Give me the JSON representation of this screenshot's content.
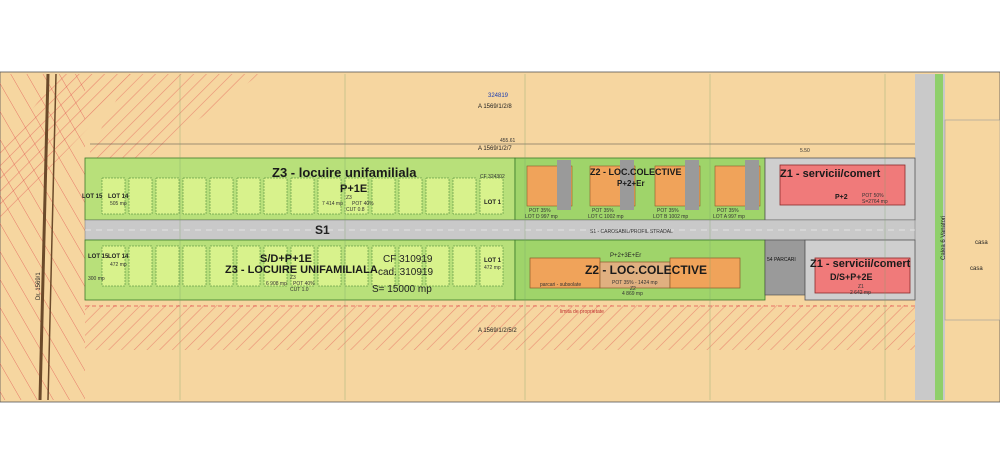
{
  "colors": {
    "background": "#f6d6a0",
    "z3_zone": "#b8e07a",
    "z3_lot": "#d8f28c",
    "z2_zone": "#9fd46a",
    "z2_building": "#f0a35a",
    "z1_building": "#f07a7a",
    "road": "#c9c9c9",
    "hatch": "#e05050",
    "grey_block": "#9a9a9a"
  },
  "top_strip": {
    "cad_number": "324819",
    "parcel_top": "A 1569/1/2/8",
    "parcel_mid": "A 1569/1/2/7",
    "dim_top": "455.61",
    "dim_right": "5.50"
  },
  "zones": {
    "z3_north": {
      "title": "Z3 - locuire unifamiliala",
      "regime": "P+1E",
      "info_name": "Z3",
      "info_area": "7 414 mp",
      "info_pot": "POT 40%",
      "info_cut": "CUT 0.8",
      "cf_label": "CF 324302"
    },
    "z3_south": {
      "regime": "S/D+P+1E",
      "title": "Z3 - LOCUIRE UNIFAMILIALA",
      "info_name": "Z3",
      "info_area": "6 908 mp",
      "info_pot": "POT 40%",
      "info_cut": "CUT 1.0"
    },
    "z2_north": {
      "title": "Z2 - LOC.COLECTIVE",
      "regime": "P+2+Er",
      "lots": [
        {
          "name": "LOT D",
          "area": "997 mp",
          "pot": "POT 35%"
        },
        {
          "name": "LOT C",
          "area": "1002 mp",
          "pot": "POT 35%"
        },
        {
          "name": "LOT B",
          "area": "1002 mp",
          "pot": "POT 35%"
        },
        {
          "name": "LOT A",
          "area": "997 mp",
          "pot": "POT 35%"
        }
      ]
    },
    "z2_south": {
      "title": "Z2 - LOC.COLECTIVE",
      "regime": "P+2+3E+Er",
      "info_name": "Z2",
      "info_area": "4 869 mp",
      "info_pot": "POT 35% - 1424 mp",
      "parking_note": "parcari - subsolate"
    },
    "z1_north": {
      "title": "Z1 - servicii/comert",
      "regime": "P+2",
      "pot": "POT 50%",
      "area": "S=2764 mp"
    },
    "z1_south": {
      "title": "Z1 - servicii/comert",
      "regime": "D/S+P+2E",
      "info_name": "Z1",
      "info_area": "2 642 mp"
    }
  },
  "lots_west": {
    "lot15_north": "LOT 15",
    "lot14_north": "LOT 14",
    "lot14_north_area": "505 mp",
    "lot14_south": "LOT 14",
    "lot14_south_area": "472 mp",
    "lot15_south": "LOT 15",
    "lot15_south_area": "300 mp",
    "lot1_north": "LOT 1",
    "lot1_south": "LOT 1",
    "lot1_south_area": "472 mp"
  },
  "road": {
    "name": "S1",
    "profile_label": "S1 - CAROSABIL/PROFIL STRADAL",
    "parking_label": "54 PARCARI"
  },
  "parcel_info": {
    "cf": "CF 310919",
    "cad": "cad. 310919",
    "area": "S= 15000 mp"
  },
  "south": {
    "parcel_bottom": "A 1569/1/2/5/2",
    "limit_note": "limita de proprietate"
  },
  "right_side": {
    "road_name": "Calea 6 Vanatori",
    "house1": "casa",
    "house2": "casa"
  },
  "left_side": {
    "road_name": "Dr. 1569/1"
  }
}
